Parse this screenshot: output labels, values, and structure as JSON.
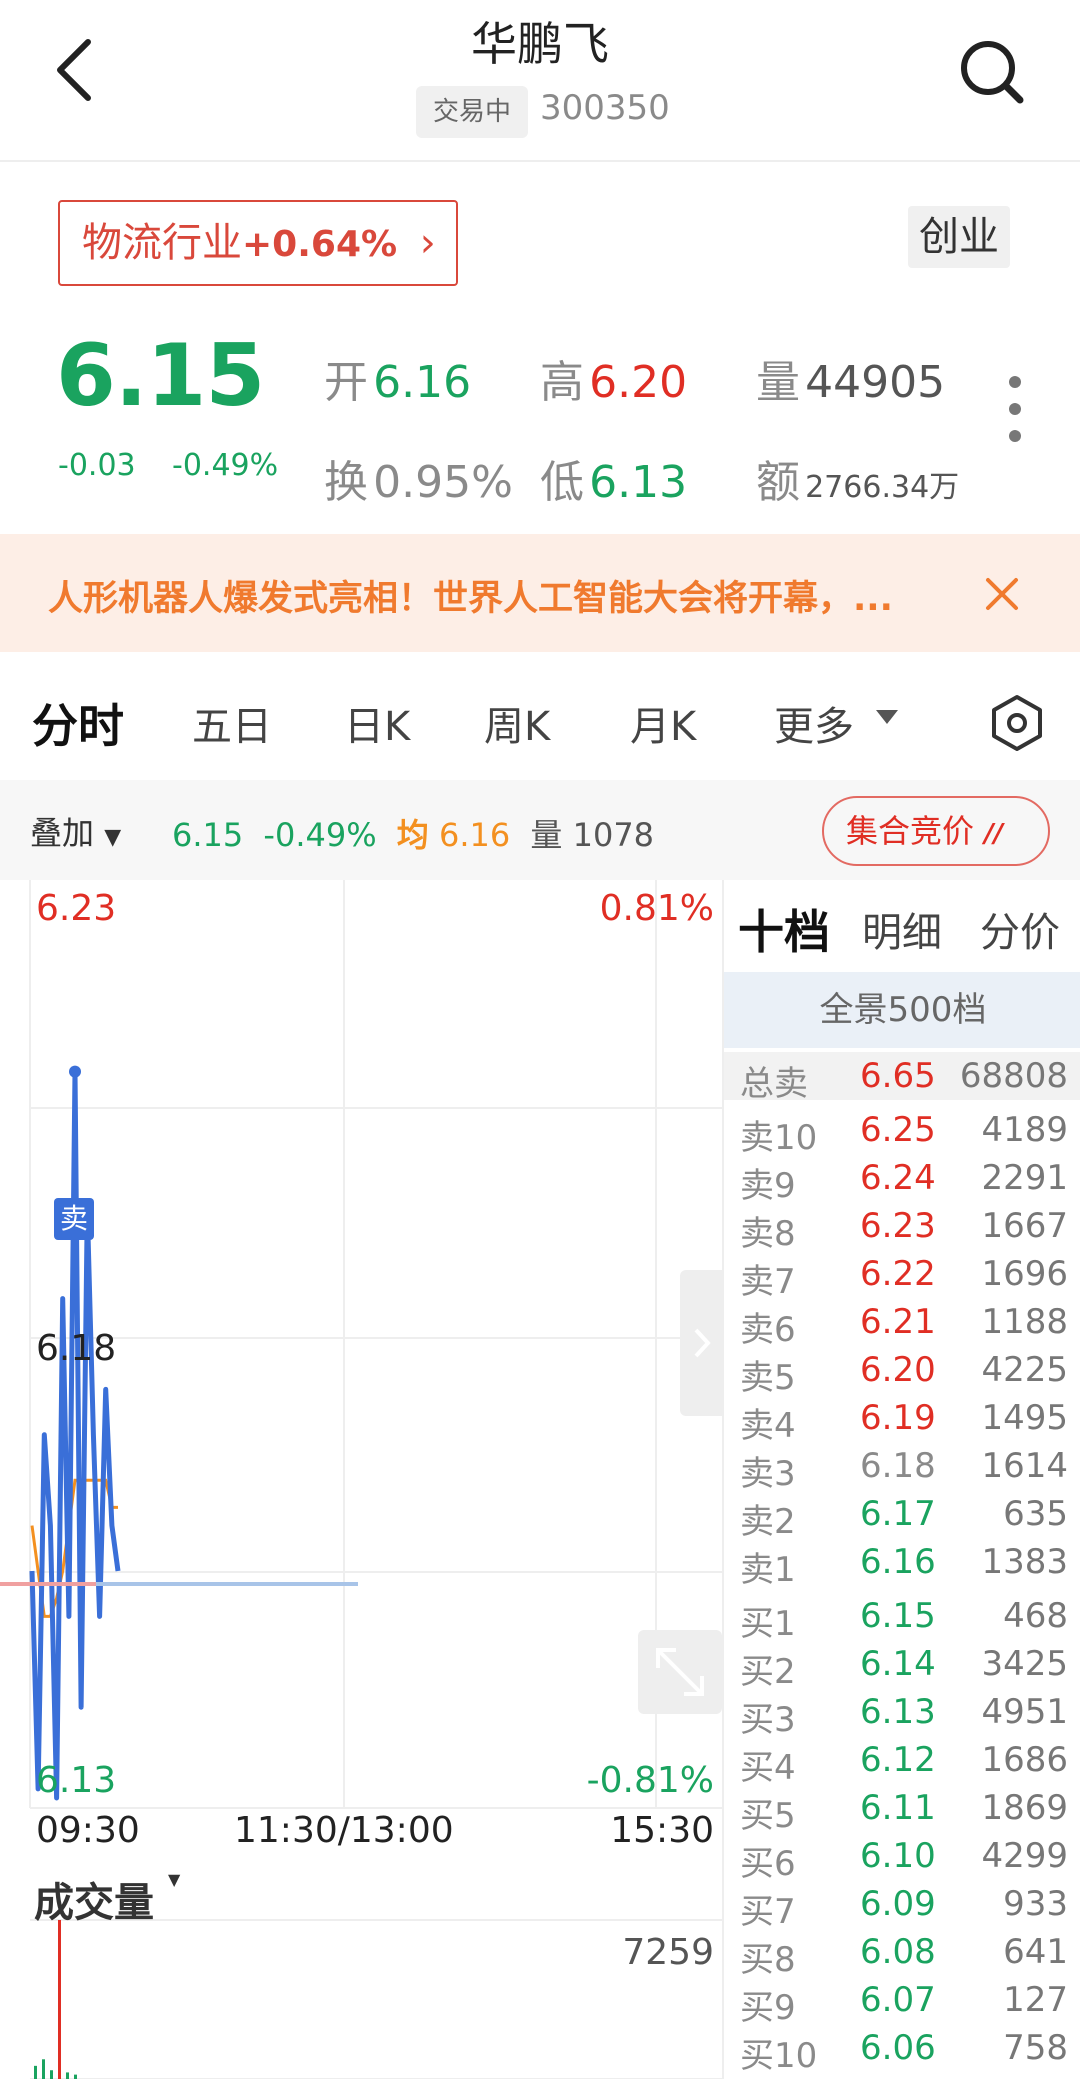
{
  "header": {
    "title": "华鹏飞",
    "status": "交易中",
    "code": "300350"
  },
  "sector": {
    "name": "物流行业",
    "change": "+0.64%",
    "arrow": "›",
    "board": "创业"
  },
  "quote": {
    "price": "6.15",
    "change": "-0.03",
    "change_pct": "-0.49%",
    "open_label": "开",
    "open": "6.16",
    "high_label": "高",
    "high": "6.20",
    "volume_label": "量",
    "volume": "44905",
    "turnover_label": "换",
    "turnover": "0.95%",
    "low_label": "低",
    "low": "6.13",
    "amount_label": "额",
    "amount": "2766.34万"
  },
  "banner": {
    "text": "人形机器人爆发式亮相！世界人工智能大会将开幕，...",
    "close_icon": "close-icon"
  },
  "tabs": [
    {
      "label": "分时"
    },
    {
      "label": "五日"
    },
    {
      "label": "日K"
    },
    {
      "label": "周K"
    },
    {
      "label": "月K"
    },
    {
      "label": "更多"
    }
  ],
  "overlay": {
    "label": "叠加",
    "price": "6.15",
    "pct": "-0.49%",
    "avg_label": "均",
    "avg": "6.16",
    "vol_label": "量",
    "vol": "1078",
    "bid_button": "集合竞价"
  },
  "colors": {
    "up": "#e02e24",
    "down": "#1aa35f",
    "price_line": "#3a6fd8",
    "avg_line": "#f39020",
    "avg_text": "#f39020"
  },
  "chart_data": {
    "type": "line",
    "y_top_price": "6.23",
    "y_mid_price": "6.18",
    "y_bottom_price": "6.13",
    "y_top_pct": "0.81%",
    "y_bottom_pct": "-0.81%",
    "ylim": [
      6.13,
      6.23
    ],
    "x_ticks": [
      "09:30",
      "11:30/13:00",
      "15:30"
    ],
    "marker_label": "卖",
    "series": [
      {
        "values": [
          6.155,
          6.131,
          6.17,
          6.16,
          6.13,
          6.185,
          6.15,
          6.21,
          6.14,
          6.195,
          6.17,
          6.15,
          6.175,
          6.16,
          6.155
        ]
      },
      {
        "values": [
          6.16,
          6.155,
          6.15,
          6.15,
          6.152,
          6.155,
          6.16,
          6.165,
          6.165,
          6.165,
          6.165,
          6.165,
          6.165,
          6.162,
          6.162
        ]
      }
    ],
    "volume_label": "成交量",
    "volume_max": "7259",
    "volume_values": [
      600,
      900,
      400,
      7259,
      300,
      200
    ]
  },
  "orderbook": {
    "tabs": [
      "十档",
      "明细",
      "分价"
    ],
    "full_label": "全景500档",
    "total": {
      "label": "总卖",
      "price": "6.65",
      "vol": "68808"
    },
    "asks": [
      {
        "label": "卖10",
        "price": "6.25",
        "vol": "4189",
        "dir": "up"
      },
      {
        "label": "卖9",
        "price": "6.24",
        "vol": "2291",
        "dir": "up"
      },
      {
        "label": "卖8",
        "price": "6.23",
        "vol": "1667",
        "dir": "up"
      },
      {
        "label": "卖7",
        "price": "6.22",
        "vol": "1696",
        "dir": "up"
      },
      {
        "label": "卖6",
        "price": "6.21",
        "vol": "1188",
        "dir": "up"
      },
      {
        "label": "卖5",
        "price": "6.20",
        "vol": "4225",
        "dir": "up"
      },
      {
        "label": "卖4",
        "price": "6.19",
        "vol": "1495",
        "dir": "up"
      },
      {
        "label": "卖3",
        "price": "6.18",
        "vol": "1614",
        "dir": "flat"
      },
      {
        "label": "卖2",
        "price": "6.17",
        "vol": "635",
        "dir": "down"
      },
      {
        "label": "卖1",
        "price": "6.16",
        "vol": "1383",
        "dir": "down"
      }
    ],
    "bids": [
      {
        "label": "买1",
        "price": "6.15",
        "vol": "468",
        "dir": "down"
      },
      {
        "label": "买2",
        "price": "6.14",
        "vol": "3425",
        "dir": "down"
      },
      {
        "label": "买3",
        "price": "6.13",
        "vol": "4951",
        "dir": "down"
      },
      {
        "label": "买4",
        "price": "6.12",
        "vol": "1686",
        "dir": "down"
      },
      {
        "label": "买5",
        "price": "6.11",
        "vol": "1869",
        "dir": "down"
      },
      {
        "label": "买6",
        "price": "6.10",
        "vol": "4299",
        "dir": "down"
      },
      {
        "label": "买7",
        "price": "6.09",
        "vol": "933",
        "dir": "down"
      },
      {
        "label": "买8",
        "price": "6.08",
        "vol": "641",
        "dir": "down"
      },
      {
        "label": "买9",
        "price": "6.07",
        "vol": "127",
        "dir": "down"
      },
      {
        "label": "买10",
        "price": "6.06",
        "vol": "758",
        "dir": "down"
      }
    ]
  }
}
